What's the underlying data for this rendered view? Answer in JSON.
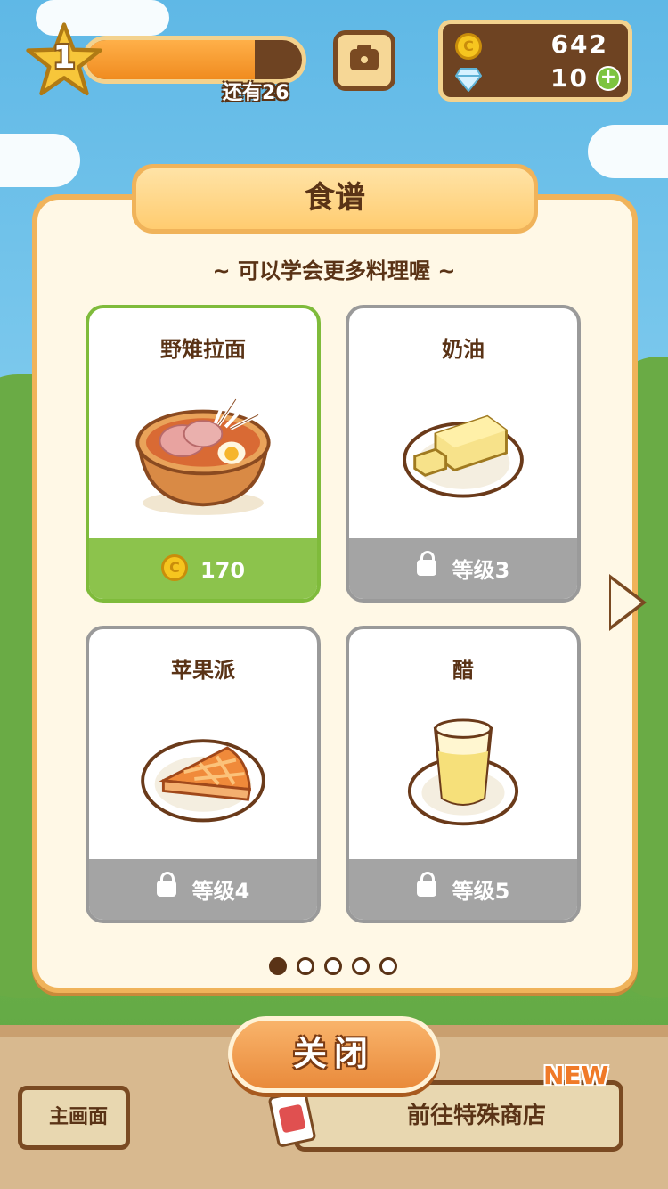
{
  "hud": {
    "level": "1",
    "xp_fraction": 0.78,
    "xp_remaining_text": "还有26",
    "coins": "642",
    "gems": "10",
    "coin_glyph": "C",
    "plus_glyph": "+"
  },
  "panel": {
    "title": "食谱",
    "subtitle": "~ 可以学会更多料理喔 ~"
  },
  "recipes": [
    {
      "name": "野雉拉面",
      "footer": "170",
      "state": "unlocked"
    },
    {
      "name": "奶油",
      "footer": "等级3",
      "state": "locked"
    },
    {
      "name": "苹果派",
      "footer": "等级4",
      "state": "locked"
    },
    {
      "name": "醋",
      "footer": "等级5",
      "state": "locked"
    }
  ],
  "pagination": {
    "total": 5,
    "current": 1
  },
  "buttons": {
    "close": "关闭",
    "main": "主画面",
    "shop": "前往特殊商店",
    "new_badge": "NEW"
  },
  "colors": {
    "active_card": "#8cc34c",
    "locked_card": "#a4a4a4",
    "panel_border": "#f0b35a",
    "text_brown": "#5a3316"
  }
}
